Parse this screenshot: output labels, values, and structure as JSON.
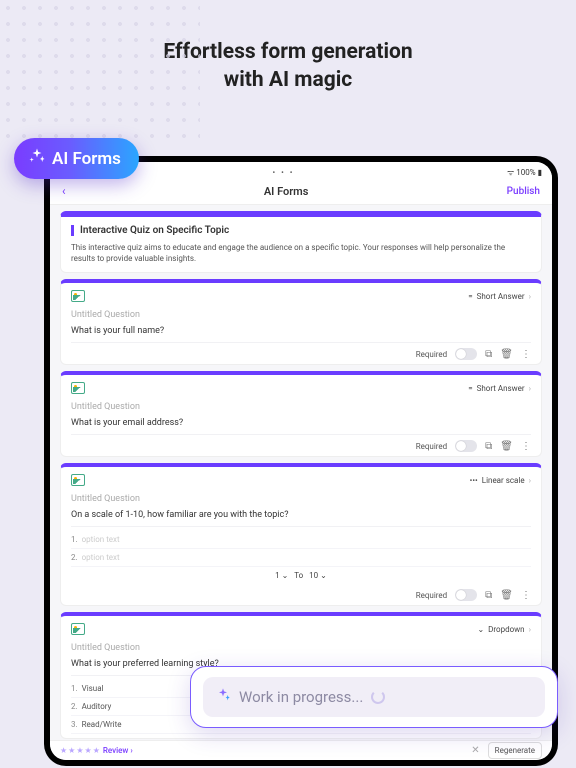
{
  "hero": {
    "line1": "Effortless form generation",
    "line2": "with AI magic"
  },
  "pill": {
    "label": "AI Forms"
  },
  "status": {
    "battery": "100%"
  },
  "topbar": {
    "title": "AI Forms",
    "publish": "Publish"
  },
  "form": {
    "title": "Interactive Quiz on Specific Topic",
    "desc": "This interactive quiz aims to educate and engage the audience on a specific topic. Your responses will help personalize the results to provide valuable insights."
  },
  "labels": {
    "untitled": "Untitled Question",
    "required": "Required",
    "shortAnswer": "Short Answer",
    "linearScale": "Linear scale",
    "dropdown": "Dropdown",
    "to": "To",
    "optionPh": "option text",
    "review": "Review",
    "regenerate": "Regenerate"
  },
  "q1": {
    "text": "What is your full name?"
  },
  "q2": {
    "text": "What is your email address?"
  },
  "q3": {
    "text": "On a scale of 1-10, how familiar are you with the topic?",
    "from": "1",
    "toVal": "10"
  },
  "q4": {
    "text": "What is your preferred learning style?",
    "opts": [
      "Visual",
      "Auditory",
      "Read/Write"
    ]
  },
  "overlay": {
    "text": "Work in progress..."
  }
}
